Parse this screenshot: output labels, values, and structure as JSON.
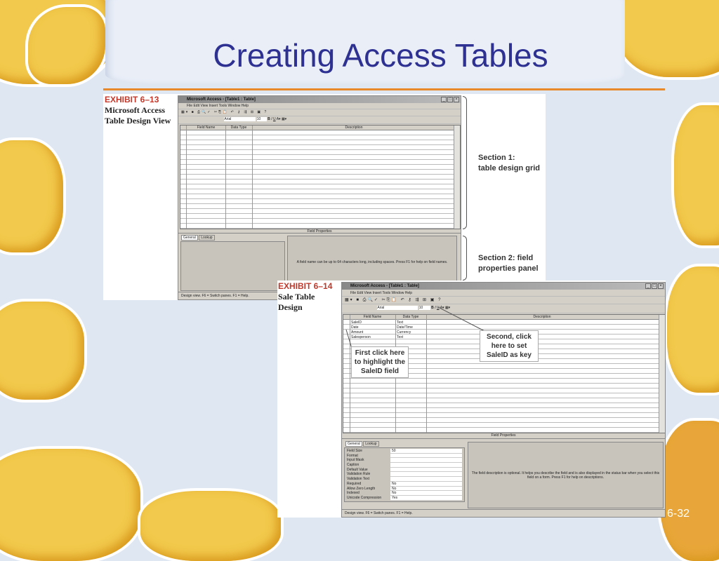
{
  "slide": {
    "title": "Creating Access Tables",
    "page_number": "6-32"
  },
  "exhibit1": {
    "number": "EXHIBIT 6–13",
    "caption": "Microsoft Access Table Design View",
    "window_title": "Microsoft Access - [Table1 : Table]",
    "menu": [
      "File",
      "Edit",
      "View",
      "Insert",
      "Tools",
      "Window",
      "Help"
    ],
    "font_name": "Arial",
    "font_size": "10",
    "columns": [
      "Field Name",
      "Data Type",
      "Description"
    ],
    "field_properties_label": "Field Properties",
    "tabs": [
      "General",
      "Lookup"
    ],
    "help_text": "A field name can be up to 64 characters long, including spaces.  Press F1 for help on field names.",
    "status": "Design view.  F6 = Switch panes.  F1 = Help.",
    "section1": [
      "Section 1:",
      "table design grid"
    ],
    "section2": [
      "Section 2: field",
      "properties panel"
    ]
  },
  "exhibit2": {
    "number": "EXHIBIT 6–14",
    "caption": "Sale Table Design",
    "window_title": "Microsoft Access - [Table1 : Table]",
    "menu": [
      "File",
      "Edit",
      "View",
      "Insert",
      "Tools",
      "Window",
      "Help"
    ],
    "font_name": "Arial",
    "font_size": "10",
    "columns": [
      "Field Name",
      "Data Type",
      "Description"
    ],
    "fields": [
      {
        "name": "SaleID",
        "type": "Text"
      },
      {
        "name": "Date",
        "type": "Date/Time"
      },
      {
        "name": "Amount",
        "type": "Currency"
      },
      {
        "name": "Salesperson",
        "type": "Text"
      }
    ],
    "field_properties_label": "Field Properties",
    "tabs": [
      "General",
      "Lookup"
    ],
    "properties": [
      {
        "k": "Field Size",
        "v": "50"
      },
      {
        "k": "Format",
        "v": ""
      },
      {
        "k": "Input Mask",
        "v": ""
      },
      {
        "k": "Caption",
        "v": ""
      },
      {
        "k": "Default Value",
        "v": ""
      },
      {
        "k": "Validation Rule",
        "v": ""
      },
      {
        "k": "Validation Text",
        "v": ""
      },
      {
        "k": "Required",
        "v": "No"
      },
      {
        "k": "Allow Zero Length",
        "v": "No"
      },
      {
        "k": "Indexed",
        "v": "No"
      },
      {
        "k": "Unicode Compression",
        "v": "Yes"
      }
    ],
    "help_text": "The field description is optional.  It helps you describe the field and is also displayed in the status bar when you select this field on a form.  Press F1 for help on descriptions.",
    "status": "Design view.  F6 = Switch panes.  F1 = Help.",
    "callout_key": "Second, click here to set SaleID as key",
    "callout_field": "First click here to highlight the SaleID field"
  }
}
